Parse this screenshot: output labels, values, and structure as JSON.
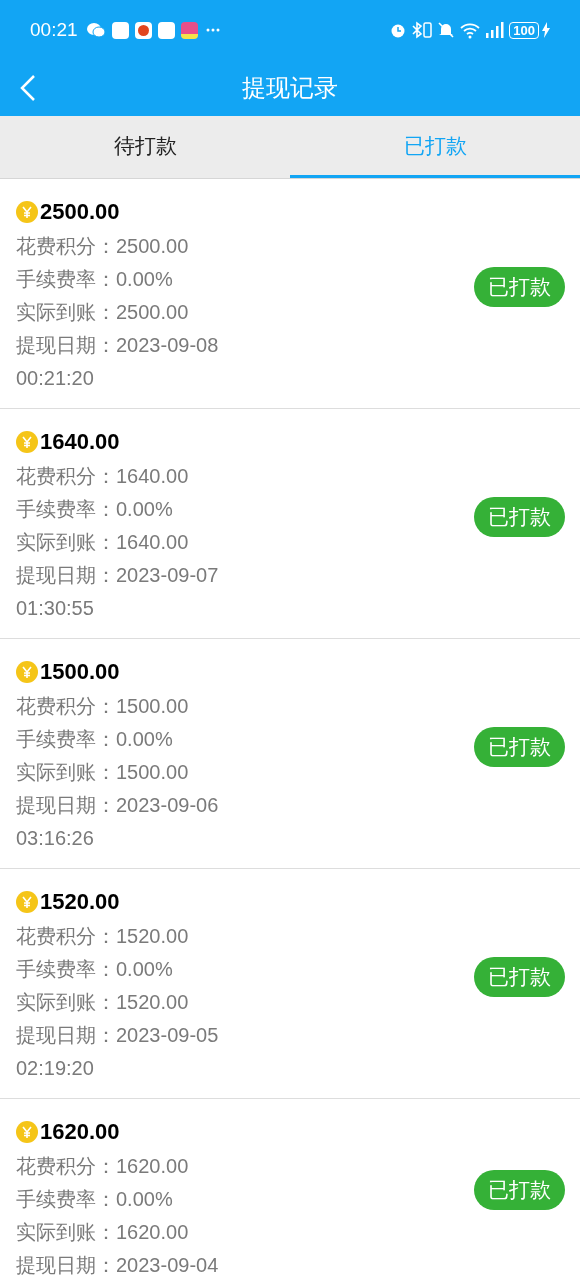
{
  "status_bar": {
    "time": "00:21",
    "battery": "100"
  },
  "nav": {
    "title": "提现记录"
  },
  "tabs": [
    {
      "label": "待打款",
      "selected": false
    },
    {
      "label": "已打款",
      "selected": true
    }
  ],
  "records": [
    {
      "amount": "2500.00",
      "fields": [
        {
          "label": "花费积分：",
          "value": "2500.00"
        },
        {
          "label": "手续费率：",
          "value": "0.00%"
        },
        {
          "label": "实际到账：",
          "value": "2500.00"
        },
        {
          "label": "提现日期：",
          "value": "2023-09-08 00:21:20"
        }
      ],
      "status": "已打款"
    },
    {
      "amount": "1640.00",
      "fields": [
        {
          "label": "花费积分：",
          "value": "1640.00"
        },
        {
          "label": "手续费率：",
          "value": "0.00%"
        },
        {
          "label": "实际到账：",
          "value": "1640.00"
        },
        {
          "label": "提现日期：",
          "value": "2023-09-07 01:30:55"
        }
      ],
      "status": "已打款"
    },
    {
      "amount": "1500.00",
      "fields": [
        {
          "label": "花费积分：",
          "value": "1500.00"
        },
        {
          "label": "手续费率：",
          "value": "0.00%"
        },
        {
          "label": "实际到账：",
          "value": "1500.00"
        },
        {
          "label": "提现日期：",
          "value": "2023-09-06 03:16:26"
        }
      ],
      "status": "已打款"
    },
    {
      "amount": "1520.00",
      "fields": [
        {
          "label": "花费积分：",
          "value": "1520.00"
        },
        {
          "label": "手续费率：",
          "value": "0.00%"
        },
        {
          "label": "实际到账：",
          "value": "1520.00"
        },
        {
          "label": "提现日期：",
          "value": "2023-09-05 02:19:20"
        }
      ],
      "status": "已打款"
    },
    {
      "amount": "1620.00",
      "fields": [
        {
          "label": "花费积分：",
          "value": "1620.00"
        },
        {
          "label": "手续费率：",
          "value": "0.00%"
        },
        {
          "label": "实际到账：",
          "value": "1620.00"
        },
        {
          "label": "提现日期：",
          "value": "2023-09-04"
        }
      ],
      "status": "已打款"
    }
  ]
}
